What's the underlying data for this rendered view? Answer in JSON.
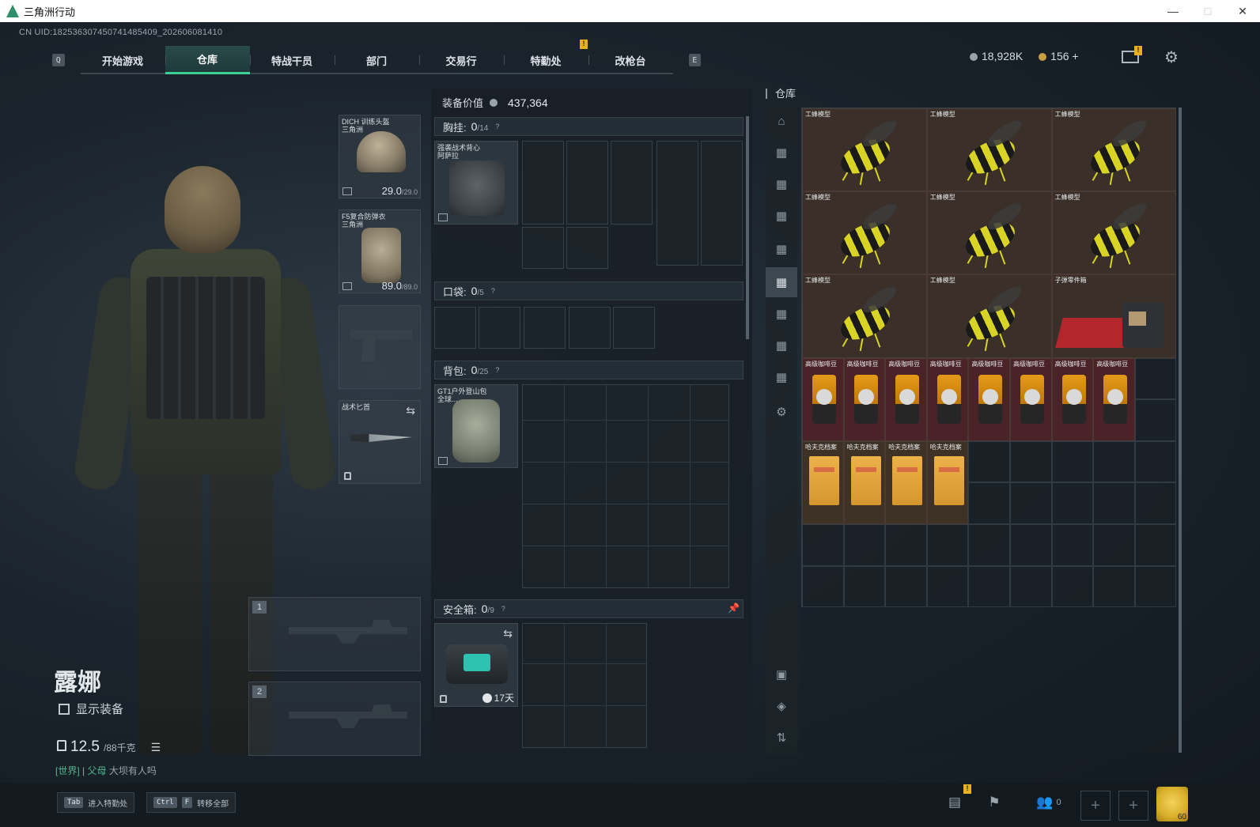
{
  "window": {
    "title": "三角洲行动",
    "controls": [
      "—",
      "□",
      "✕"
    ]
  },
  "header": {
    "uid": "CN UID:18253630745074148540​9_202606081410",
    "left_key": "Q",
    "right_key": "E",
    "tabs": [
      "开始游戏",
      "仓库",
      "特战干员",
      "部门",
      "交易行",
      "特勤处",
      "改枪台"
    ],
    "active_tab": "仓库",
    "alert_mark": "!",
    "silver": "18,928K",
    "gold": "156",
    "gold_add": "+",
    "mail_alert": "!"
  },
  "character": {
    "name": "露娜",
    "show_equipment_label": "显示装备",
    "weight_value": "12.5",
    "weight_max": "/88千克",
    "chat_channel": "[世界]",
    "chat_sep": "|",
    "chat_user": "父母",
    "chat_text": "大坝有人吗"
  },
  "equip_slots": {
    "helmet": {
      "name": "DICH 训练头盔",
      "source": "三角洲",
      "durability": "29.0",
      "max": "/29.0"
    },
    "armor": {
      "name": "F5复合防弹衣",
      "source": "三角洲",
      "durability": "89.0",
      "max": "/89.0"
    },
    "knife": {
      "name": "战术匕首"
    },
    "weapon1_num": "1",
    "weapon2_num": "2"
  },
  "loadout": {
    "value_label": "装备价值",
    "value": "437,364",
    "chest": {
      "label": "胸挂:",
      "count": "0",
      "cap": "/14",
      "item_name": "强袭战术背心",
      "item_source": "阿萨拉"
    },
    "pocket": {
      "label": "口袋:",
      "count": "0",
      "cap": "/5"
    },
    "backpack": {
      "label": "背包:",
      "count": "0",
      "cap": "/25",
      "item_name": "GT1户外登山包",
      "item_source": "全球..."
    },
    "safebox": {
      "label": "安全箱:",
      "count": "0",
      "cap": "/9",
      "timer": "17天"
    },
    "help": "?"
  },
  "warehouse": {
    "title": "仓库",
    "items": {
      "bee_label": "工蜂模型",
      "bullet_label": "子弹零件箱",
      "coffee_label": "高级咖啡豆",
      "folder_label": "哈夫克档案"
    }
  },
  "bottom": {
    "hint1_key": "Tab",
    "hint1_text": "进入特勤处",
    "hint2_key1": "Ctrl",
    "hint2_key2": "F",
    "hint2_text": "转移全部",
    "team_count": "0",
    "level": "60",
    "alert_mark": "!"
  }
}
